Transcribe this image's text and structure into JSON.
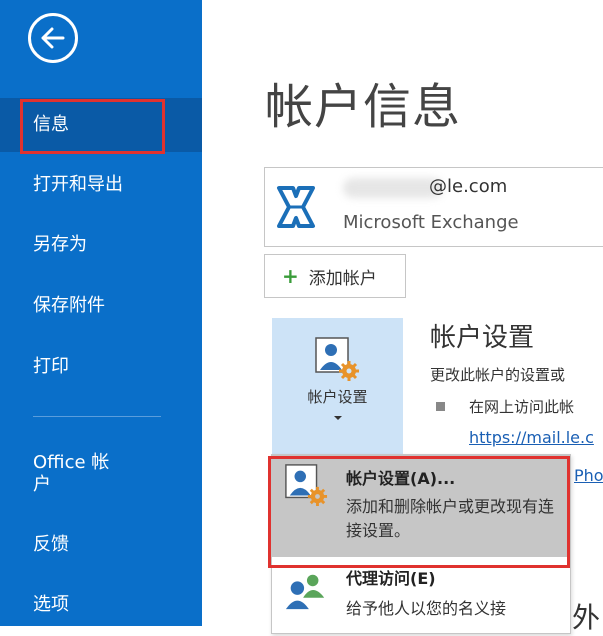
{
  "sidebar": {
    "back_icon": "back-arrow-icon",
    "items": [
      {
        "label": "信息",
        "active": true
      },
      {
        "label": "打开和导出"
      },
      {
        "label": "另存为"
      },
      {
        "label": "保存附件"
      },
      {
        "label": "打印"
      },
      {
        "label": "Office 帐户"
      },
      {
        "label": "反馈"
      },
      {
        "label": "选项"
      }
    ]
  },
  "main": {
    "title": "帐户信息",
    "account": {
      "email_suffix": "@le.com",
      "type": "Microsoft Exchange",
      "icon": "exchange-logo-icon"
    },
    "add_account_label": "添加帐户",
    "settings_tile": {
      "label": "帐户设置",
      "icon": "account-settings-icon"
    },
    "settings_section": {
      "heading": "帐户设置",
      "description": "更改此帐户的设置或",
      "bullet": "在网上访问此帐",
      "link1": "https://mail.le.c",
      "link2": "Pho"
    },
    "dropdown": [
      {
        "title": "帐户设置(A)...",
        "description": "添加和删除帐户或更改现有连接设置。",
        "icon": "account-settings-icon"
      },
      {
        "title": "代理访问(E)",
        "description": "给予他人以您的名义接",
        "icon": "delegate-users-icon"
      }
    ],
    "partial_text": "外"
  },
  "colors": {
    "sidebar_bg": "#0a6fc9",
    "sidebar_active": "#0a5aa6",
    "highlight_red": "#e0322f",
    "tile_bg": "#cde3f7",
    "link": "#1a5fb4"
  }
}
